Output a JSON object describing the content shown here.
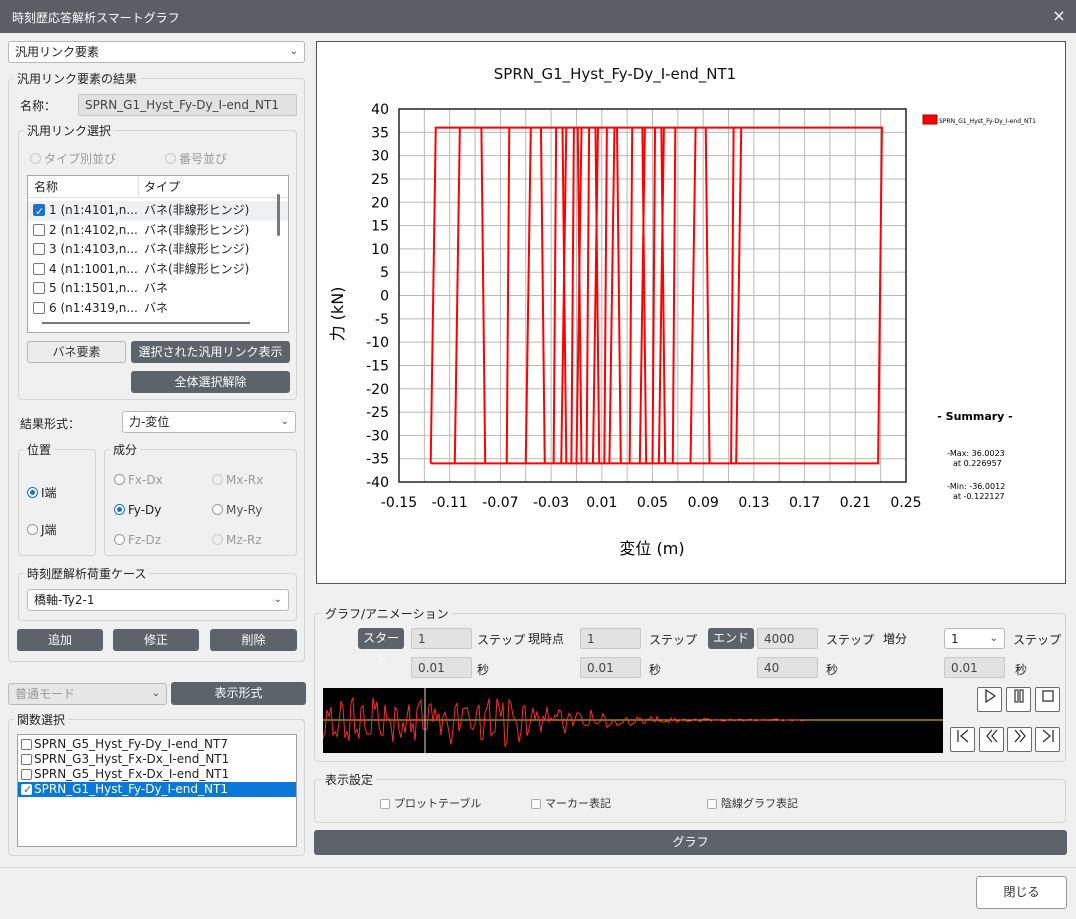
{
  "window": {
    "title": "時刻歴応答解析スマートグラフ",
    "close_icon": "×"
  },
  "left": {
    "element_type": "汎用リンク要素",
    "results_group": "汎用リンク要素の結果",
    "name_label": "名称：",
    "name_value": "SPRN_G1_Hyst_Fy-Dy_I-end_NT1",
    "link_select_group": "汎用リンク選択",
    "sort_type": "タイプ別並び",
    "sort_number": "番号並び",
    "table": {
      "headers": [
        "名称",
        "タイプ"
      ],
      "rows": [
        {
          "checked": true,
          "name": "1 (n1:4101,n...",
          "type": "バネ(非線形ヒンジ)"
        },
        {
          "checked": false,
          "name": "2 (n1:4102,n...",
          "type": "バネ(非線形ヒンジ)"
        },
        {
          "checked": false,
          "name": "3 (n1:4103,n...",
          "type": "バネ(非線形ヒンジ)"
        },
        {
          "checked": false,
          "name": "4 (n1:1001,n...",
          "type": "バネ(非線形ヒンジ)"
        },
        {
          "checked": false,
          "name": "5 (n1:1501,n...",
          "type": "バネ"
        },
        {
          "checked": false,
          "name": "6 (n1:4319,n...",
          "type": "バネ"
        }
      ]
    },
    "spring_btn": "バネ要素",
    "show_selected_btn": "選択された汎用リンク表示",
    "deselect_all_btn": "全体選択解除",
    "result_format_label": "結果形式：",
    "result_format_value": "力-変位",
    "position_group": "位置",
    "pos_i": "I端",
    "pos_j": "J端",
    "component_group": "成分",
    "comp": {
      "fxdx": "Fx-Dx",
      "fydy": "Fy-Dy",
      "fzdz": "Fz-Dz",
      "mxrx": "Mx-Rx",
      "myry": "My-Ry",
      "mzrz": "Mz-Rz"
    },
    "loadcase_group": "時刻歴解析荷重ケース",
    "loadcase_value": "橋軸-Ty2-1",
    "add_btn": "追加",
    "modify_btn": "修正",
    "delete_btn": "削除",
    "mode_value": "普通モード",
    "display_format_btn": "表示形式",
    "func_group": "関数選択",
    "functions": [
      {
        "checked": false,
        "label": "SPRN_G5_Hyst_Fy-Dy_I-end_NT7"
      },
      {
        "checked": false,
        "label": "SPRN_G3_Hyst_Fx-Dx_I-end_NT1"
      },
      {
        "checked": false,
        "label": "SPRN_G5_Hyst_Fx-Dx_I-end_NT1"
      },
      {
        "checked": true,
        "label": "SPRN_G1_Hyst_Fy-Dy_I-end_NT1"
      }
    ]
  },
  "chart_data": {
    "type": "line",
    "title": "SPRN_G1_Hyst_Fy-Dy_I-end_NT1",
    "xlabel": "変位 (m)",
    "ylabel": "力 (kN)",
    "xlim": [
      -0.15,
      0.25
    ],
    "ylim": [
      -40,
      40
    ],
    "xticks": [
      "-0.15",
      "-0.11",
      "-0.07",
      "-0.03",
      "0.01",
      "0.05",
      "0.09",
      "0.13",
      "0.17",
      "0.21",
      "0.25"
    ],
    "yticks": [
      "40",
      "35",
      "30",
      "25",
      "20",
      "15",
      "10",
      "5",
      "0",
      "-5",
      "-10",
      "-15",
      "-20",
      "-25",
      "-30",
      "-35",
      "-40"
    ],
    "grid": true,
    "legend_position": "top-right",
    "series": [
      {
        "name": "SPRN_G1_Hyst_Fy-Dy_I-end_NT1",
        "color": "#ff0000",
        "envelope": {
          "x_min": -0.122127,
          "x_max": 0.226957,
          "y_min": -36.0012,
          "y_max": 36.0023
        },
        "vertical_branch_x": [
          -0.125,
          -0.106,
          -0.082,
          -0.065,
          -0.05,
          -0.035,
          -0.028,
          -0.022,
          -0.018,
          -0.014,
          -0.01,
          -0.006,
          -0.002,
          0.003,
          0.008,
          0.012,
          0.016,
          0.025,
          0.032,
          0.04,
          0.045,
          0.05,
          0.055,
          0.06,
          0.066,
          0.08,
          0.095,
          0.112,
          0.116,
          0.231
        ]
      }
    ],
    "summary": {
      "title": "- Summary -",
      "max_line": "-Max: 36.0023",
      "max_at": "at 0.226957",
      "min_line": "-Min: -36.0012",
      "min_at": "at -0.122127"
    }
  },
  "animation": {
    "group": "グラフ/アニメーション",
    "start_btn": "スタート",
    "start_step": "1",
    "start_sec": "0.01",
    "step_unit": "ステップ",
    "sec_unit": "秒",
    "current_label": "現時点",
    "current_step": "1",
    "current_sec": "0.01",
    "end_btn": "エンド",
    "end_step": "4000",
    "end_sec": "40",
    "increment_label": "増分",
    "increment_value": "1",
    "increment_sec": "0.01",
    "controls": [
      "play-icon",
      "pause-icon",
      "stop-icon",
      "first-icon",
      "rewind-icon",
      "fast-forward-icon",
      "last-icon"
    ]
  },
  "display": {
    "group": "表示設定",
    "plot_table": "プロットテーブル",
    "marker": "マーカー表記",
    "hidden_line": "陰線グラフ表記"
  },
  "graph_btn": "グラフ",
  "close_btn": "閉じる"
}
